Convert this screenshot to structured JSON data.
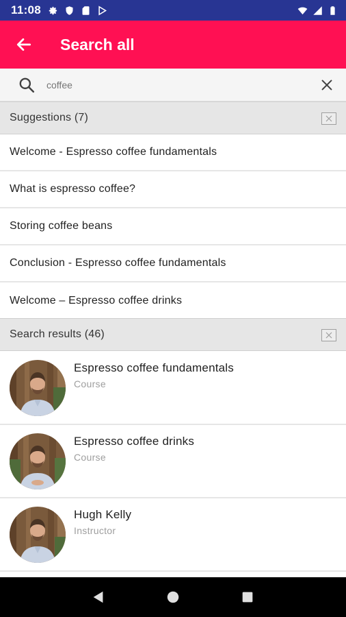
{
  "status_bar": {
    "time": "11:08",
    "left_icons": [
      "gear-icon",
      "shield-icon",
      "sim-card-icon",
      "play-store-icon"
    ],
    "right_icons": [
      "wifi-icon",
      "signal-icon",
      "battery-icon"
    ]
  },
  "app_bar": {
    "back_icon": "arrow-left-icon",
    "title": "Search all",
    "color": "#ff1053"
  },
  "search": {
    "icon": "search-icon",
    "value": "coffee",
    "clear_icon": "close-icon"
  },
  "suggestions": {
    "title": "Suggestions (7)",
    "dismiss_icon": "close-box-icon",
    "items": [
      {
        "label": "Welcome - Espresso coffee fundamentals"
      },
      {
        "label": "What is espresso coffee?"
      },
      {
        "label": "Storing coffee beans"
      },
      {
        "label": "Conclusion - Espresso coffee fundamentals"
      },
      {
        "label": "Welcome – Espresso coffee drinks"
      }
    ]
  },
  "results": {
    "title": "Search results (46)",
    "dismiss_icon": "close-box-icon",
    "items": [
      {
        "title": "Espresso coffee fundamentals",
        "type": "Course"
      },
      {
        "title": "Espresso coffee drinks",
        "type": "Course"
      },
      {
        "title": "Hugh Kelly",
        "type": "Instructor"
      }
    ]
  },
  "nav_bar": {
    "buttons": [
      "back-triangle-icon",
      "home-circle-icon",
      "recents-square-icon"
    ]
  }
}
